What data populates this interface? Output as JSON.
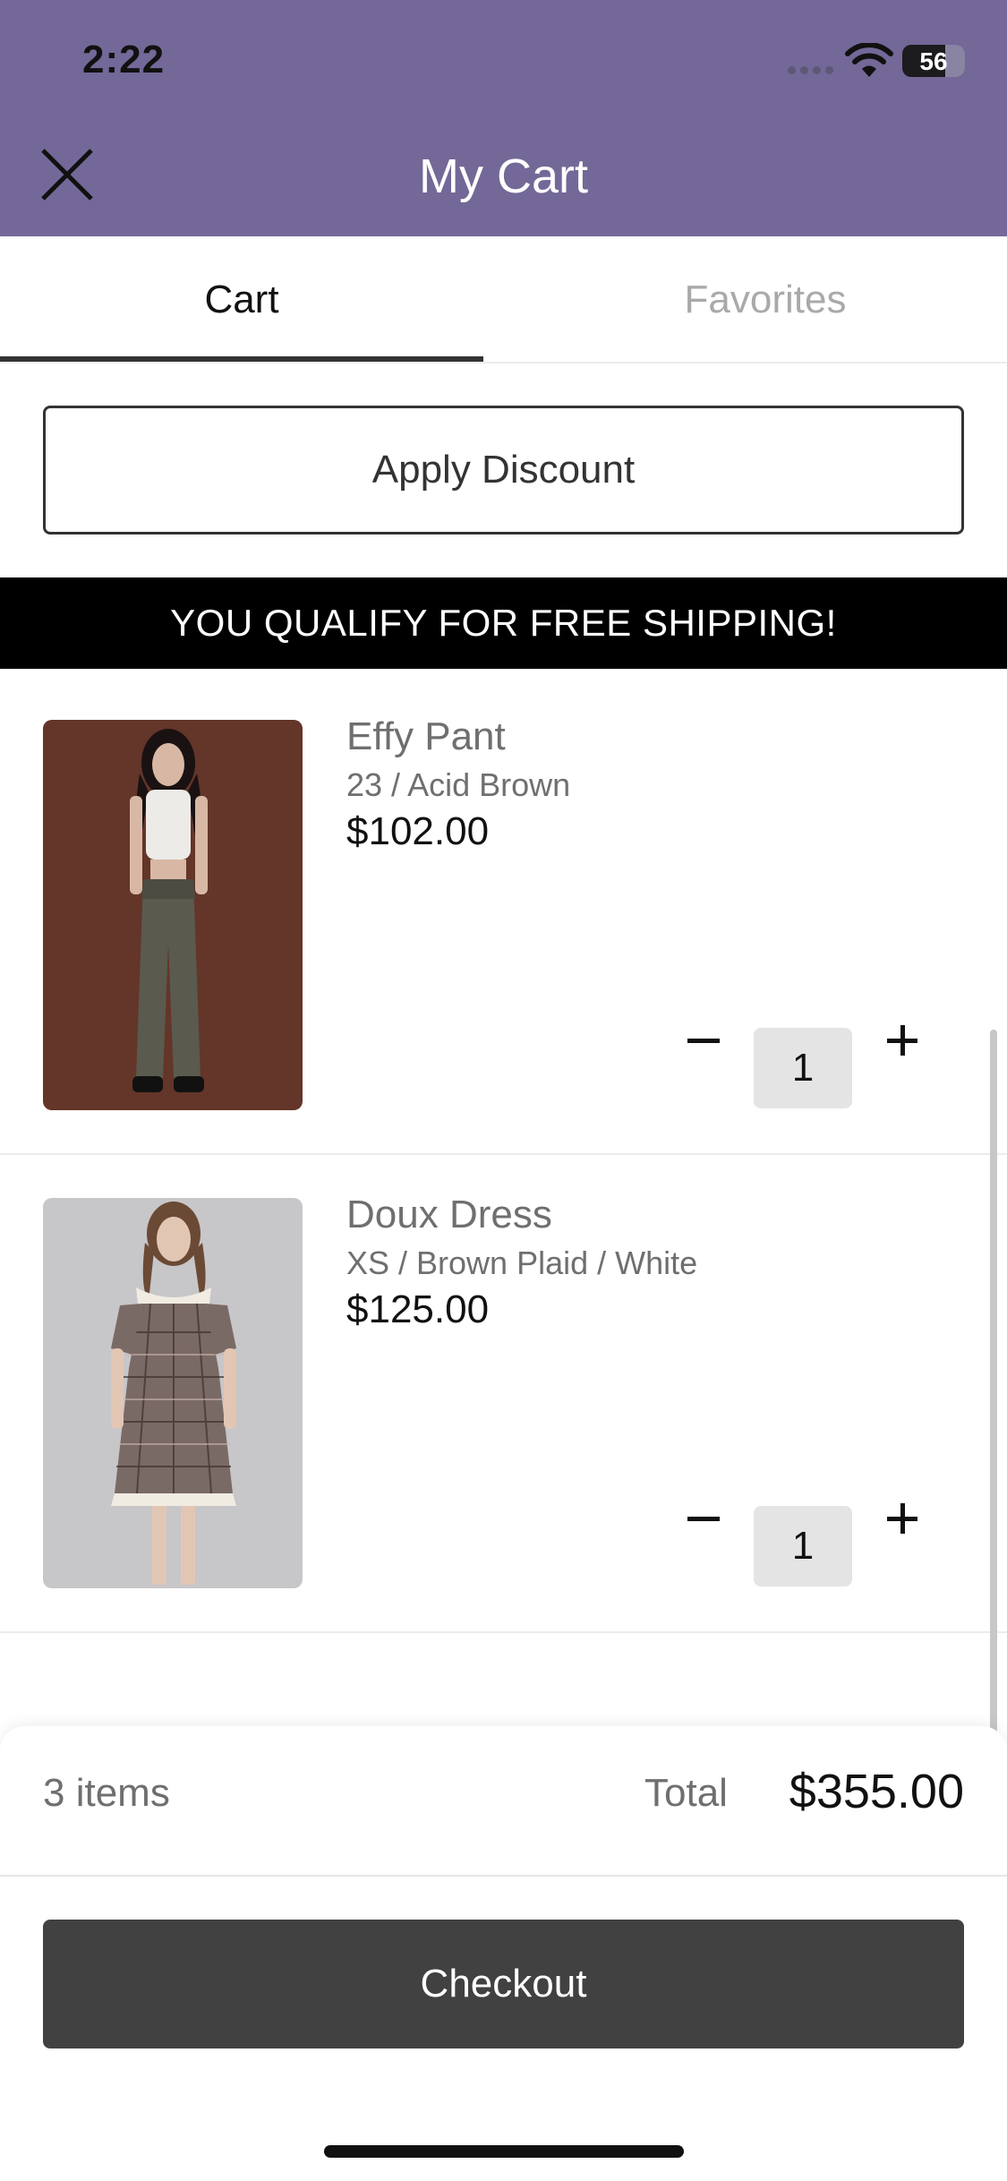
{
  "status_bar": {
    "time": "2:22",
    "battery": "56"
  },
  "header": {
    "title": "My Cart"
  },
  "tabs": [
    {
      "label": "Cart",
      "active": true
    },
    {
      "label": "Favorites",
      "active": false
    }
  ],
  "discount_button": "Apply Discount",
  "banner": "YOU QUALIFY FOR FREE SHIPPING!",
  "items": [
    {
      "name": "Effy Pant",
      "variant": "23 / Acid Brown",
      "price": "$102.00",
      "quantity": "1"
    },
    {
      "name": "Doux Dress",
      "variant": "XS / Brown Plaid / White",
      "price": "$125.00",
      "quantity": "1"
    }
  ],
  "summary": {
    "count": "3 items",
    "total_label": "Total",
    "total": "$355.00"
  },
  "checkout_button": "Checkout",
  "colors": {
    "header_bg": "#736897",
    "banner_bg": "#000000",
    "checkout_bg": "#414141"
  }
}
